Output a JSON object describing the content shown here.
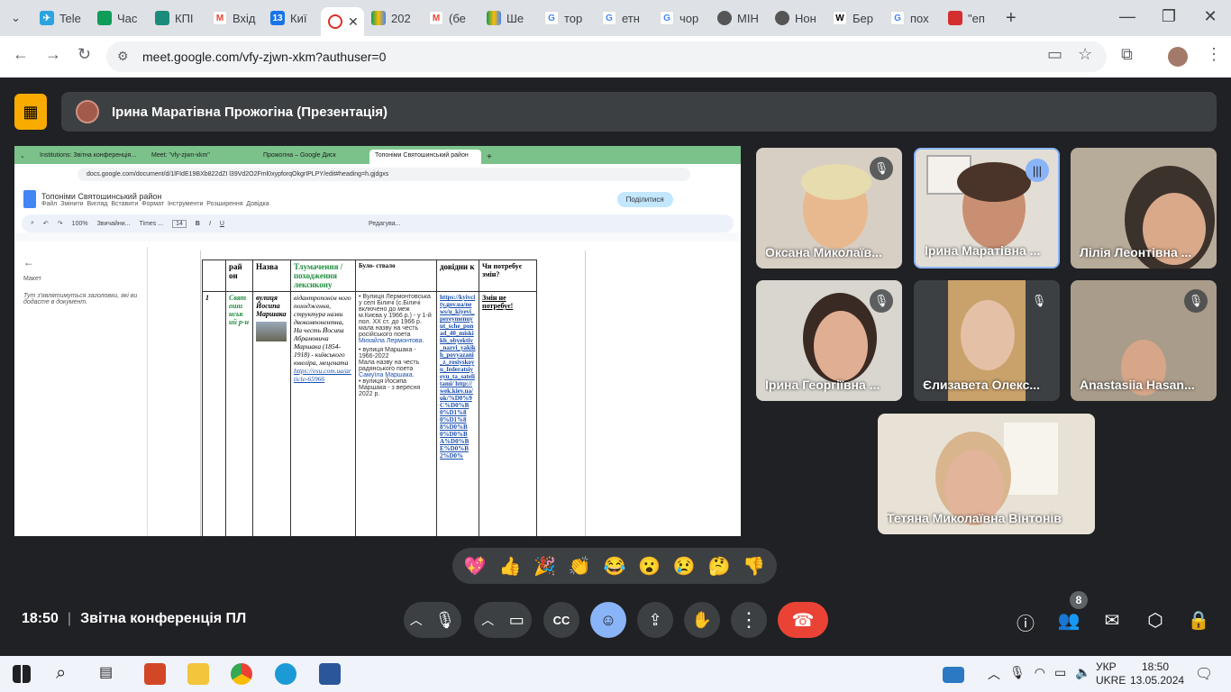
{
  "browser": {
    "tabs": [
      "Tele",
      "Час",
      "КПІ",
      "Вхід",
      "Киї",
      "",
      "202",
      "(бе",
      "Ше",
      "тор",
      "етн",
      "чор",
      "МІН",
      "Нон",
      "Бер",
      "пох",
      "\"еп"
    ],
    "active_tab_index": 5,
    "url": "meet.google.com/vfy-zjwn-xkm?authuser=0"
  },
  "meeting": {
    "presenter_banner": "Ірина Маратівна Прожогіна (Презентація)",
    "time": "18:50",
    "separator": "|",
    "title": "Звітна конференція ПЛ",
    "participant_count": "8"
  },
  "presentation": {
    "tabs": [
      "Institutions: Звітна конференція...",
      "Meet: \"vfy-zjwn-xkm\"",
      "Прожогіна – Google Диск",
      "Топоніми Святошинський район"
    ],
    "doc_url": "docs.google.com/document/d/1lFIdE19BXb822dZI l39Vd2O2Fml0xypforqOkgrIPLPY/edit#heading=h.gjdgxs",
    "doc_title": "Топоніми Святошинський район",
    "menu": [
      "Файл",
      "Змінити",
      "Вигляд",
      "Вставити",
      "Формат",
      "Інструменти",
      "Розширення",
      "Довідка"
    ],
    "share": "Поділитися",
    "zoom": "100%",
    "style": "Звичайни...",
    "font": "Times ...",
    "font_size": "14",
    "edit_mode": "Редагува...",
    "outline_title": "Макет",
    "outline_hint": "Тут з'являтимуться заголовки, які ви додасте в документ.",
    "table": {
      "headers": [
        "рай он",
        "Назва",
        "Тлумачення / походження лексикону",
        "Було- ствало",
        "довідни к",
        "Чи потребує змін?"
      ],
      "row": {
        "num": "1",
        "district": "Свят оши нськ ий р-н",
        "name": "вулиця Йосипа Маршака",
        "meaning": "відантропонім ного походження, структура назви двокомпонентна, На честь Йосипа Абрамовича Маршака (1854-1918) - київського ювеліра, мецената",
        "meaning_link": "https://esu.com.ua/article-65966",
        "history_1": "Вулиця Лермонтовська у селі Біличі (с.Біличі включено до меж м.Києва у 1966 р.) - у 1-й пол. XX ст. до 1966 р. мала назву на честь російського поета",
        "history_1_link": "Михайла Лермонтова.",
        "history_2": "вулиця Маршака - 1966-2022",
        "history_2b": "Мала назву на честь радянського поета",
        "history_2b_link": "Самуїла Маршака.",
        "history_3": "вулиця Йосипа Маршака - з вересня 2022 р.",
        "ref": "https://kyivcity.gov.ua/news/u_kiyevi_pereymenuyut_sche_ponad_40_miskikh_obyektiv_nazvi_yakikh_povyazani_z_rosiyskoyu_federatsiyeyu_ta_sateli tami/ http://wek.kiev.ua/uk/%D0%9C%D0%B0%D1%80%D1%88%D0%B0%D0%BA%D0%BE%D0%B2%D0%",
        "change": "Змін не потребує!"
      }
    }
  },
  "participants": [
    {
      "name": "Оксана Миколаїв...",
      "muted": true
    },
    {
      "name": "Ірина Маратівна ...",
      "muted": false,
      "speaking": true
    },
    {
      "name": "Лілія Леонтівна ...",
      "muted": false
    },
    {
      "name": "Ірина Георгіївна ...",
      "muted": true
    },
    {
      "name": "Єлизавета Олекс...",
      "muted": true
    },
    {
      "name": "Anastasiia Hasan...",
      "muted": true
    },
    {
      "name": "Тетяна Миколаївна Вінтонів",
      "muted": false
    }
  ],
  "reactions": [
    "💖",
    "👍",
    "🎉",
    "👏",
    "😂",
    "😮",
    "😢",
    "🤔",
    "👎"
  ],
  "taskbar": {
    "lang_top": "УКР",
    "lang_bottom": "UKRE",
    "time": "18:50",
    "date": "13.05.2024"
  },
  "colors": {
    "end_call": "#ea4335",
    "accent_blue": "#8ab4f8",
    "present_yellow": "#f9ab00"
  }
}
